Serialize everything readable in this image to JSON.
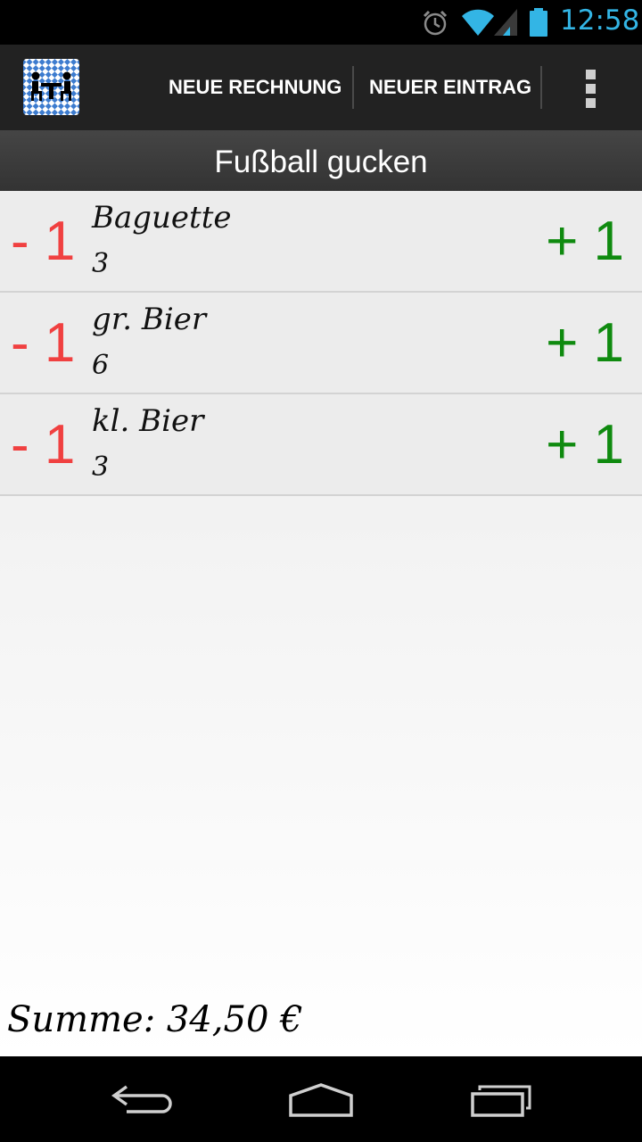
{
  "status_bar": {
    "time": "12:58",
    "icons": [
      "alarm-icon",
      "wifi-icon",
      "signal-icon",
      "battery-icon"
    ],
    "accent_color": "#33b5e5"
  },
  "action_bar": {
    "logo_icon": "table-with-people-icon",
    "buttons": [
      "NEUE RECHNUNG",
      "NEUER EINTRAG"
    ],
    "overflow_icon": "overflow-menu-icon"
  },
  "bill": {
    "title": "Fußball gucken",
    "items": [
      {
        "name": "Baguette",
        "count": "3",
        "minus_label": "- 1",
        "plus_label": "+ 1"
      },
      {
        "name": "gr. Bier",
        "count": "6",
        "minus_label": "- 1",
        "plus_label": "+ 1"
      },
      {
        "name": "kl. Bier",
        "count": "3",
        "minus_label": "- 1",
        "plus_label": "+ 1"
      }
    ],
    "sum_text": "Summe: 34,50 €",
    "minus_color": "#f04040",
    "plus_color": "#0f8a0f"
  },
  "nav_bar": {
    "icons": [
      "back-icon",
      "home-icon",
      "recent-apps-icon"
    ]
  }
}
